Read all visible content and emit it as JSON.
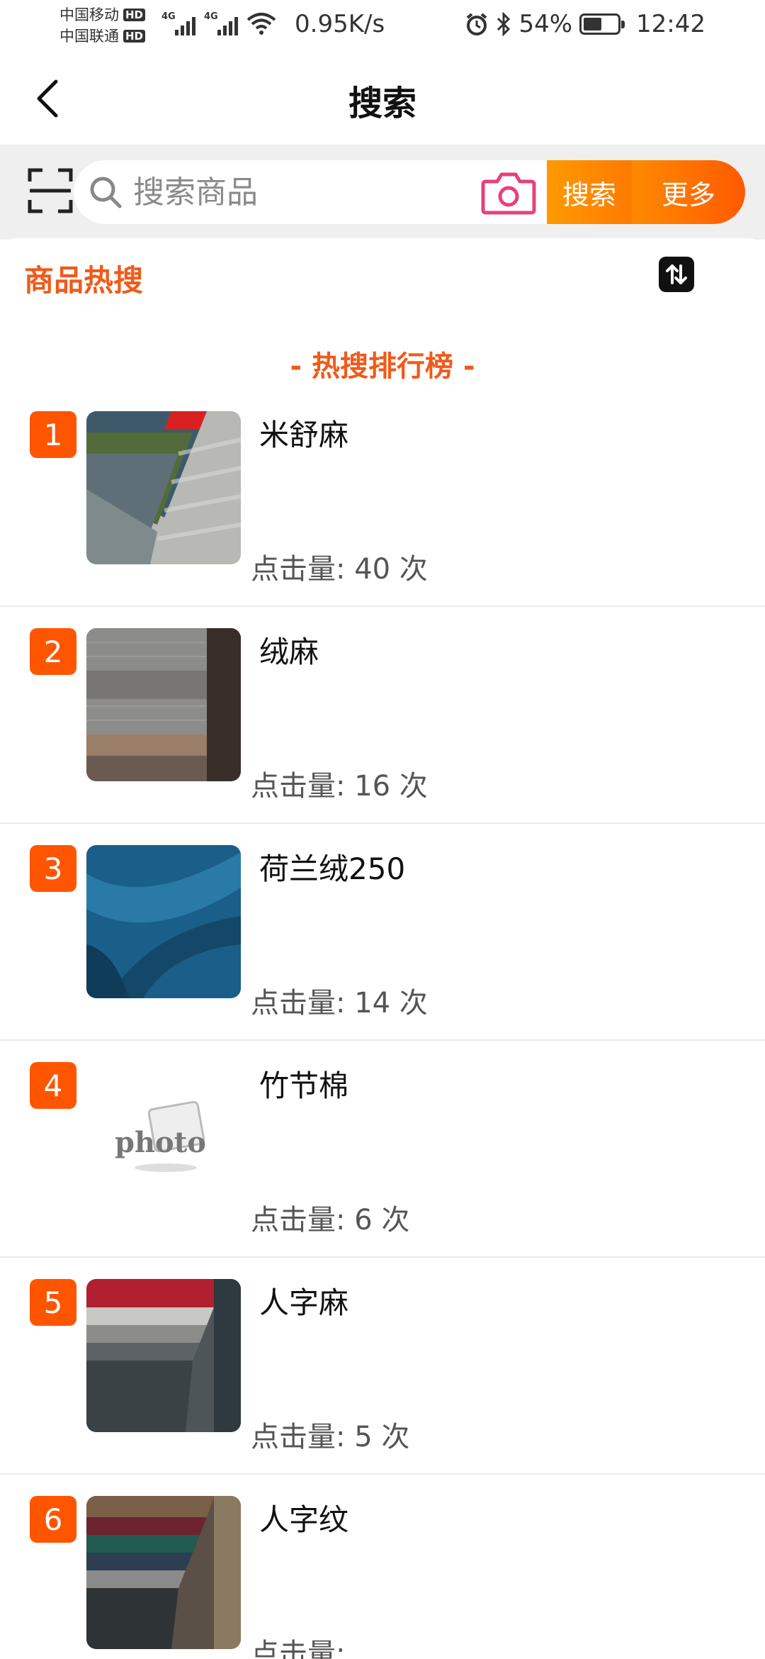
{
  "status_bar": {
    "carrier1": "中国移动",
    "carrier2": "中国联通",
    "hd": "HD",
    "network_tag": "4G",
    "net_speed": "0.95K/s",
    "battery_percent": "54%",
    "battery_level": 0.54,
    "time": "12:42"
  },
  "header": {
    "title": "搜索"
  },
  "search": {
    "placeholder": "搜索商品",
    "search_button": "搜索",
    "more_button": "更多"
  },
  "section": {
    "title": "商品热搜",
    "ranking_heading": "- 热搜排行榜 -"
  },
  "items": [
    {
      "rank": "1",
      "name": "米舒麻",
      "clicks": "点击量:  40 次",
      "thumb": "fabric-grey-stripe"
    },
    {
      "rank": "2",
      "name": "绒麻",
      "clicks": "点击量:  16 次",
      "thumb": "fabric-grey-brown"
    },
    {
      "rank": "3",
      "name": "荷兰绒250",
      "clicks": "点击量:  14 次",
      "thumb": "fabric-blue-velvet"
    },
    {
      "rank": "4",
      "name": "竹节棉",
      "clicks": "点击量:  6 次",
      "thumb": "photo-placeholder",
      "thumb_text": "photo"
    },
    {
      "rank": "5",
      "name": "人字麻",
      "clicks": "点击量:  5 次",
      "thumb": "fabric-herringbone"
    },
    {
      "rank": "6",
      "name": "人字纹",
      "clicks": "点击量:  ",
      "thumb": "fabric-multicolor"
    }
  ],
  "colors": {
    "accent": "#f05a1a",
    "badge": "#ff5500",
    "search_button": "#ff8a00"
  }
}
